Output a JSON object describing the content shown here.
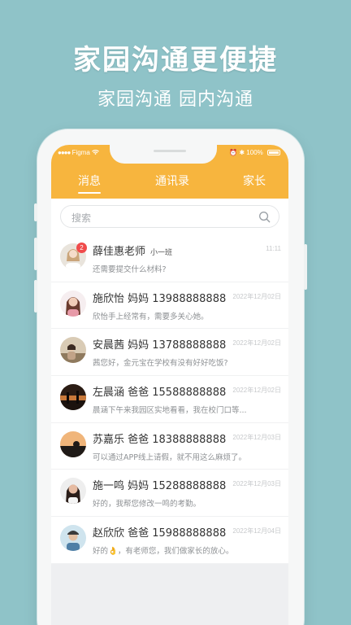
{
  "promo": {
    "headline": "家园沟通更便捷",
    "subhead": "家园沟通  园内沟通"
  },
  "status_bar": {
    "carrier": "Figma",
    "battery": "100%",
    "icons": [
      "wifi-icon",
      "alarm-icon",
      "bluetooth-icon",
      "battery-icon"
    ]
  },
  "tabs": [
    {
      "label": "消息",
      "active": true
    },
    {
      "label": "通讯录",
      "active": false
    },
    {
      "label": "家长",
      "active": false
    }
  ],
  "search": {
    "placeholder": "搜索"
  },
  "colors": {
    "background": "#8fc3c8",
    "accent": "#f7b53e",
    "badge": "#f04b4b"
  },
  "conversations": [
    {
      "name": "薛佳惠老师",
      "sub": "小一班",
      "time": "11:11",
      "preview": "还需要提交什么材料?",
      "badge": "2"
    },
    {
      "name": "施欣怡   妈妈   13988888888",
      "sub": "",
      "time": "2022年12月02日",
      "preview": "欣怡手上经常有，需要多关心她。",
      "badge": ""
    },
    {
      "name": "安晨茜   妈妈   13788888888",
      "sub": "",
      "time": "2022年12月02日",
      "preview": "茜您好，金元宝在学校有没有好好吃饭?",
      "badge": ""
    },
    {
      "name": "左晨涵   爸爸   15588888888",
      "sub": "",
      "time": "2022年12月02日",
      "preview": "晨涵下午来我园区实地看看，我在校门口等...",
      "badge": ""
    },
    {
      "name": "苏嘉乐   爸爸   18388888888",
      "sub": "",
      "time": "2022年12月03日",
      "preview": "可以通过APP线上请假，就不用这么麻烦了。",
      "badge": ""
    },
    {
      "name": "施一鸣   妈妈   15288888888",
      "sub": "",
      "time": "2022年12月03日",
      "preview": "好的，我帮您修改一鸣的考勤。",
      "badge": ""
    },
    {
      "name": "赵欣欣   爸爸   15988888888",
      "sub": "",
      "time": "2022年12月04日",
      "preview": "好的👌，有老师您，我们做家长的放心。",
      "badge": ""
    }
  ]
}
